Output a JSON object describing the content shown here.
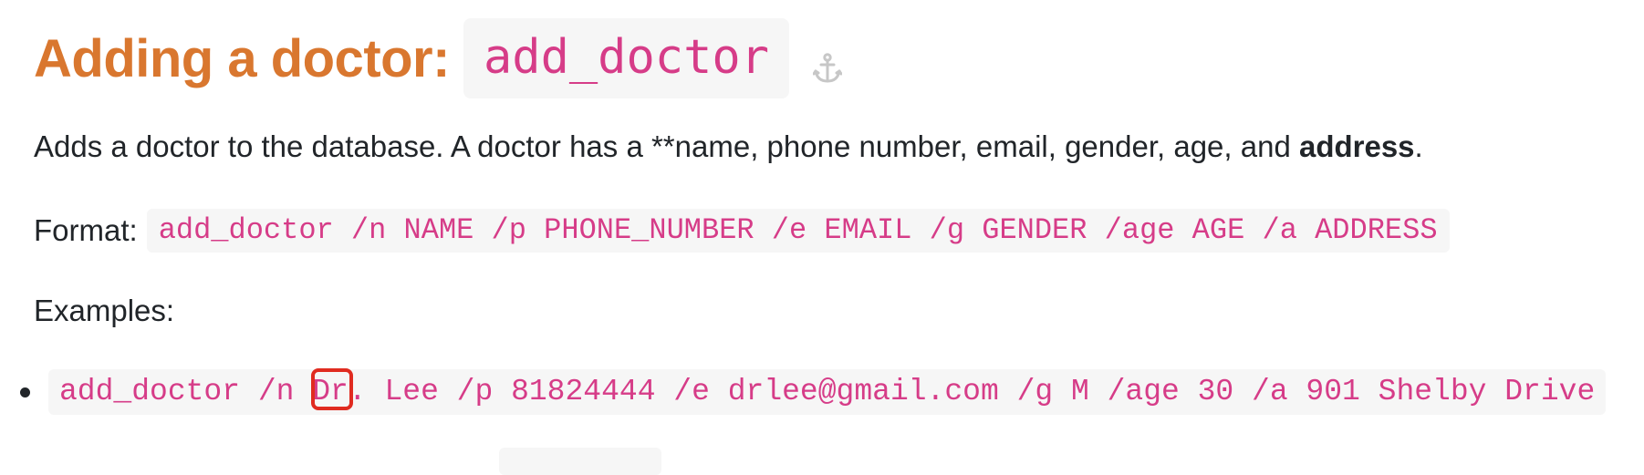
{
  "heading": {
    "text": "Adding a doctor:",
    "code": "add_doctor",
    "anchor_icon": "anchor-icon"
  },
  "description": {
    "before_bold": "Adds a doctor to the database. A doctor has a **name, phone number, email, gender, age, and ",
    "bold": "address",
    "after_bold": "."
  },
  "format": {
    "label": "Format:",
    "code": "add_doctor /n NAME /p PHONE_NUMBER /e EMAIL /g GENDER /age AGE /a ADDRESS"
  },
  "examples": {
    "label": "Examples:",
    "items": [
      "add_doctor /n Dr. Lee /p 81824444 /e drlee@gmail.com /g M /age 30 /a 901 Shelby Drive"
    ]
  },
  "colors": {
    "heading": "#d9772f",
    "code_text": "#d63c88",
    "code_bg": "#f6f6f6",
    "body_text": "#212529",
    "highlight": "#e02b20"
  }
}
